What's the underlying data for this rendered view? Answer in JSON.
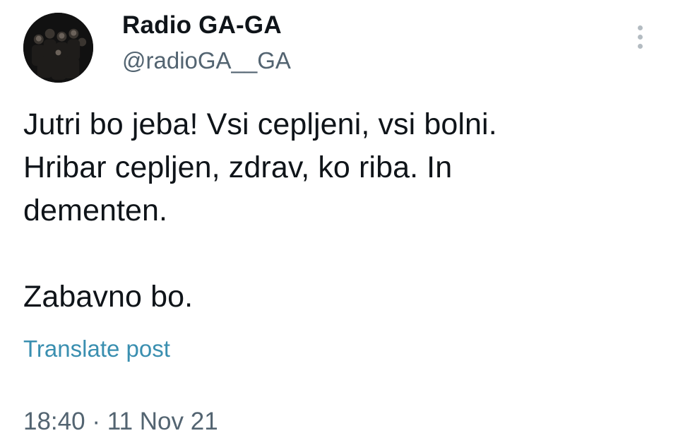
{
  "author": {
    "display_name": "Radio GA-GA",
    "handle": "@radioGA__GA",
    "avatar_icon": "band-photo-avatar"
  },
  "tweet": {
    "text": "Jutri bo jeba! Vsi cepljeni, vsi bolni.\nHribar cepljen, zdrav, ko riba. In\ndementen.\n\nZabavno bo.",
    "translate_label": "Translate post",
    "time": "18:40",
    "separator": "·",
    "date": "11 Nov 21"
  },
  "menu": {
    "icon": "more-vertical-icon"
  },
  "colors": {
    "text": "#0f1419",
    "secondary": "#536471",
    "link": "#3a8fb0",
    "background": "#ffffff"
  }
}
